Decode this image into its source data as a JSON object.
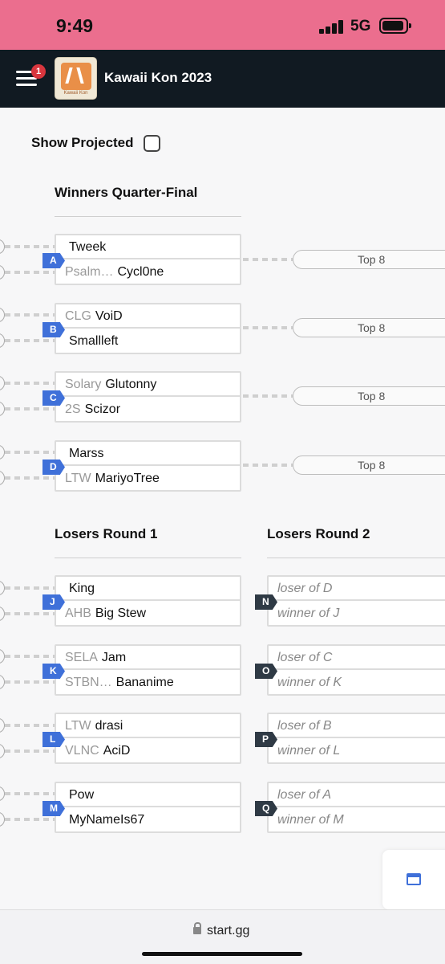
{
  "status_bar": {
    "time": "9:49",
    "network": "5G"
  },
  "header": {
    "badge_count": "1",
    "title": "Kawaii Kon 2023",
    "logo_text": "Kawaii Kon"
  },
  "toolbar": {
    "show_projected": "Show Projected"
  },
  "winners_qf": {
    "title": "Winners Quarter-Final",
    "matches": [
      {
        "id": "A",
        "p1": {
          "prefix": "",
          "name": "Tweek"
        },
        "p2": {
          "prefix": "Psalm…",
          "name": "Cycl0ne"
        },
        "next": "Top 8"
      },
      {
        "id": "B",
        "p1": {
          "prefix": "CLG",
          "name": "VoiD"
        },
        "p2": {
          "prefix": "",
          "name": "Smallleft"
        },
        "next": "Top 8"
      },
      {
        "id": "C",
        "p1": {
          "prefix": "Solary",
          "name": "Glutonny"
        },
        "p2": {
          "prefix": "2S",
          "name": "Scizor"
        },
        "next": "Top 8"
      },
      {
        "id": "D",
        "p1": {
          "prefix": "",
          "name": "Marss"
        },
        "p2": {
          "prefix": "LTW",
          "name": "MariyoTree"
        },
        "next": "Top 8"
      }
    ]
  },
  "losers_r1": {
    "title": "Losers Round 1",
    "matches": [
      {
        "id": "J",
        "p1": {
          "prefix": "",
          "name": "King"
        },
        "p2": {
          "prefix": "AHB",
          "name": "Big Stew"
        }
      },
      {
        "id": "K",
        "p1": {
          "prefix": "SELA",
          "name": "Jam"
        },
        "p2": {
          "prefix": "STBN…",
          "name": "Bananime"
        }
      },
      {
        "id": "L",
        "p1": {
          "prefix": "LTW",
          "name": "drasi"
        },
        "p2": {
          "prefix": "VLNC",
          "name": "AciD"
        }
      },
      {
        "id": "M",
        "p1": {
          "prefix": "",
          "name": "Pow"
        },
        "p2": {
          "prefix": "",
          "name": "MyNameIs67"
        }
      }
    ]
  },
  "losers_r2": {
    "title": "Losers Round 2",
    "matches": [
      {
        "id": "N",
        "p1": "loser of D",
        "p2": "winner of J"
      },
      {
        "id": "O",
        "p1": "loser of C",
        "p2": "winner of K"
      },
      {
        "id": "P",
        "p1": "loser of B",
        "p2": "winner of L"
      },
      {
        "id": "Q",
        "p1": "loser of A",
        "p2": "winner of M"
      }
    ]
  },
  "browser": {
    "url": "start.gg"
  },
  "colors": {
    "status_bar": "#eb6e8e",
    "header": "#111a22",
    "tag_blue": "#3f70d9",
    "tag_dark": "#2f3a45",
    "badge": "#d9363e"
  },
  "icons": [
    "menu-icon",
    "signal-icon",
    "battery-icon",
    "lock-icon",
    "window-icon"
  ]
}
